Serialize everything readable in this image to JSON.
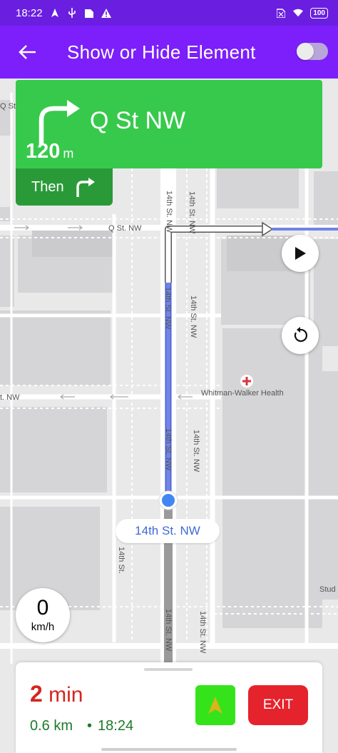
{
  "status_bar": {
    "time": "18:22",
    "left_icons": [
      "navigation-icon",
      "usb-icon",
      "sim-icon",
      "warning-icon"
    ],
    "right_icons": [
      "sim-off-icon",
      "wifi-icon"
    ],
    "battery": "100"
  },
  "app_bar": {
    "title": "Show or Hide Element",
    "toggle_on": false
  },
  "navigation": {
    "street": "Q St NW",
    "distance_value": "120",
    "distance_unit": "m",
    "then_label": "Then",
    "maneuver": "turn-right",
    "then_maneuver": "turn-right"
  },
  "map": {
    "current_street": "14th St. NW",
    "labels": {
      "q_st_left": "Q St. NW",
      "q_st_far_left": "Q St. NW",
      "fourteenth_upper": "14th St. NW",
      "fourteenth_upper_right": "14th St. NW",
      "fourteenth_mid": "14th St. NW",
      "fourteenth_mid_right": "14th St. NW",
      "fourteenth_lower": "14th St. NW",
      "fourteenth_lower_right": "14th St. NW",
      "fourteenth_bottom": "14th St. NW",
      "fourteenth_bottom_right": "14th St. NW",
      "fourteenth_left_lower": "14th St.",
      "p_st_left": "t. NW",
      "poi": "Whitman-Walker Health",
      "studio": "Stud"
    },
    "colors": {
      "route": "#6f84e6",
      "route_passed": "#9a9a9a",
      "poi": "#d9363e"
    }
  },
  "speed": {
    "value": "0",
    "unit": "km/h"
  },
  "eta": {
    "minutes": "2",
    "minutes_unit": "min",
    "distance": "0.6 km",
    "arrival": "18:24"
  },
  "buttons": {
    "exit": "EXIT"
  },
  "colors": {
    "status_bar": "#6a1fe0",
    "app_bar": "#7c1ffa",
    "nav_primary": "#37c94b",
    "nav_secondary": "#2a9a38",
    "eta_time": "#d3261f",
    "eta_details": "#1d7a2a",
    "overview_button": "#35e31b",
    "exit_button": "#e5232d"
  }
}
